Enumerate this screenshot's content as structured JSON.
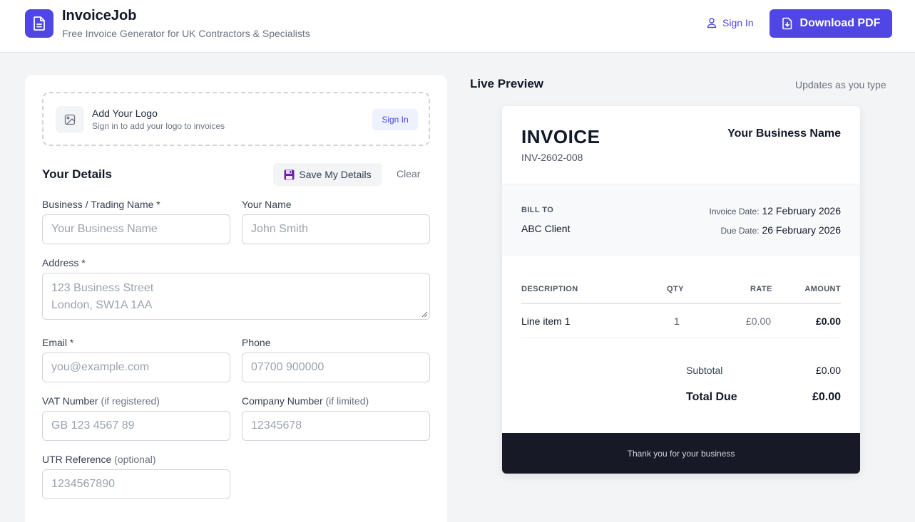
{
  "header": {
    "title": "InvoiceJob",
    "subtitle": "Free Invoice Generator for UK Contractors & Specialists",
    "signin_label": "Sign In",
    "download_label": "Download PDF",
    "accent_color": "#4f46e5"
  },
  "logo_upload": {
    "title": "Add Your Logo",
    "subtitle": "Sign in to add your logo to invoices",
    "signin_label": "Sign In",
    "icon": "image-icon"
  },
  "details": {
    "title": "Your Details",
    "save_label": "Save My Details",
    "clear_label": "Clear",
    "fields": {
      "business_name": {
        "label": "Business / Trading Name *",
        "placeholder": "Your Business Name"
      },
      "your_name": {
        "label": "Your Name",
        "placeholder": "John Smith"
      },
      "address": {
        "label": "Address *",
        "placeholder_line1": "123 Business Street",
        "placeholder_line2": "London, SW1A 1AA"
      },
      "email": {
        "label": "Email *",
        "placeholder": "you@example.com"
      },
      "phone": {
        "label": "Phone",
        "placeholder": "07700 900000"
      },
      "vat": {
        "label": "VAT Number",
        "hint": "(if registered)",
        "placeholder": "GB 123 4567 89"
      },
      "company": {
        "label": "Company Number",
        "hint": "(if limited)",
        "placeholder": "12345678"
      },
      "utr": {
        "label": "UTR Reference",
        "hint": "(optional)",
        "placeholder": "1234567890"
      }
    }
  },
  "preview": {
    "title": "Live Preview",
    "note": "Updates as you type",
    "invoice": {
      "heading": "INVOICE",
      "number": "INV-2602-008",
      "business_name": "Your Business Name",
      "bill_to_label": "BILL TO",
      "bill_to_name": "ABC Client",
      "invoice_date_label": "Invoice Date:",
      "invoice_date": "12 February 2026",
      "due_date_label": "Due Date:",
      "due_date": "26 February 2026",
      "columns": [
        "DESCRIPTION",
        "QTY",
        "RATE",
        "AMOUNT"
      ],
      "items": [
        {
          "description": "Line item 1",
          "qty": "1",
          "rate": "£0.00",
          "amount": "£0.00"
        }
      ],
      "subtotal_label": "Subtotal",
      "subtotal": "£0.00",
      "total_label": "Total Due",
      "total": "£0.00",
      "footer": "Thank you for your business"
    }
  }
}
